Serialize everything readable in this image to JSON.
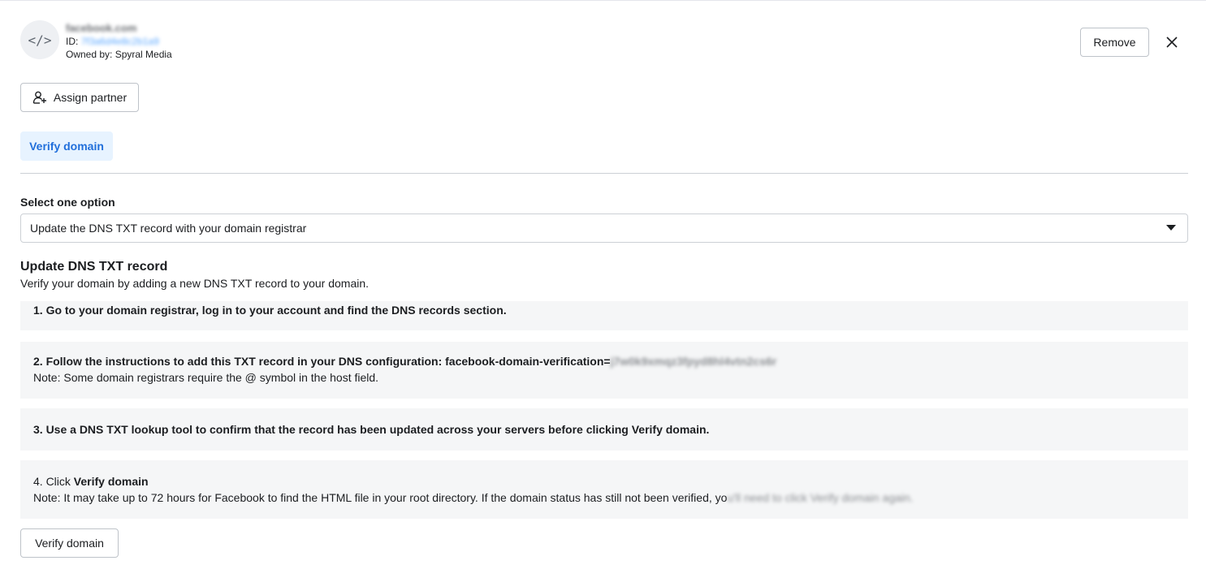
{
  "header": {
    "avatar_glyph": "</>",
    "domain_name": "facebook.com",
    "id_label": "ID:",
    "id_value": "7f3a6d4e8c2b1a9",
    "owner_label": "Owned by: Spyral Media"
  },
  "actions": {
    "remove_label": "Remove",
    "assign_partner_label": "Assign partner"
  },
  "tabs": {
    "verify_domain": "Verify domain"
  },
  "option": {
    "label": "Select one option",
    "selected": "Update the DNS TXT record with your domain registrar"
  },
  "section": {
    "title": "Update DNS TXT record",
    "description": "Verify your domain by adding a new DNS TXT record to your domain."
  },
  "steps": {
    "s1": "1. Go to your domain registrar, log in to your account and find the DNS records section.",
    "s2_main": "2. Follow the instructions to add this TXT record in your DNS configuration: facebook-domain-verification=",
    "s2_code": "j7w0k9xmqz3fpyd8hl4vtn2cs6r",
    "s2_note": "Note: Some domain registrars require the @ symbol in the host field.",
    "s3": "3. Use a DNS TXT lookup tool to confirm that the record has been updated across your servers before clicking Verify domain.",
    "s4_prefix": "4. Click ",
    "s4_bold": "Verify domain",
    "s4_note": "Note: It may take up to 72 hours for Facebook to find the HTML file in your root directory. If the domain status has still not been verified, yo",
    "s4_note_blur": "u'll need to click Verify domain again."
  },
  "footer": {
    "verify_button": "Verify domain"
  },
  "colors": {
    "accent": "#1877f2",
    "tab_bg": "#e7f3ff",
    "step_bg": "#f5f6f7",
    "border": "#bec3c9"
  },
  "icons": {
    "avatar": "code-brackets-icon",
    "close": "close-icon",
    "assign": "add-person-icon",
    "select": "caret-down-icon"
  }
}
